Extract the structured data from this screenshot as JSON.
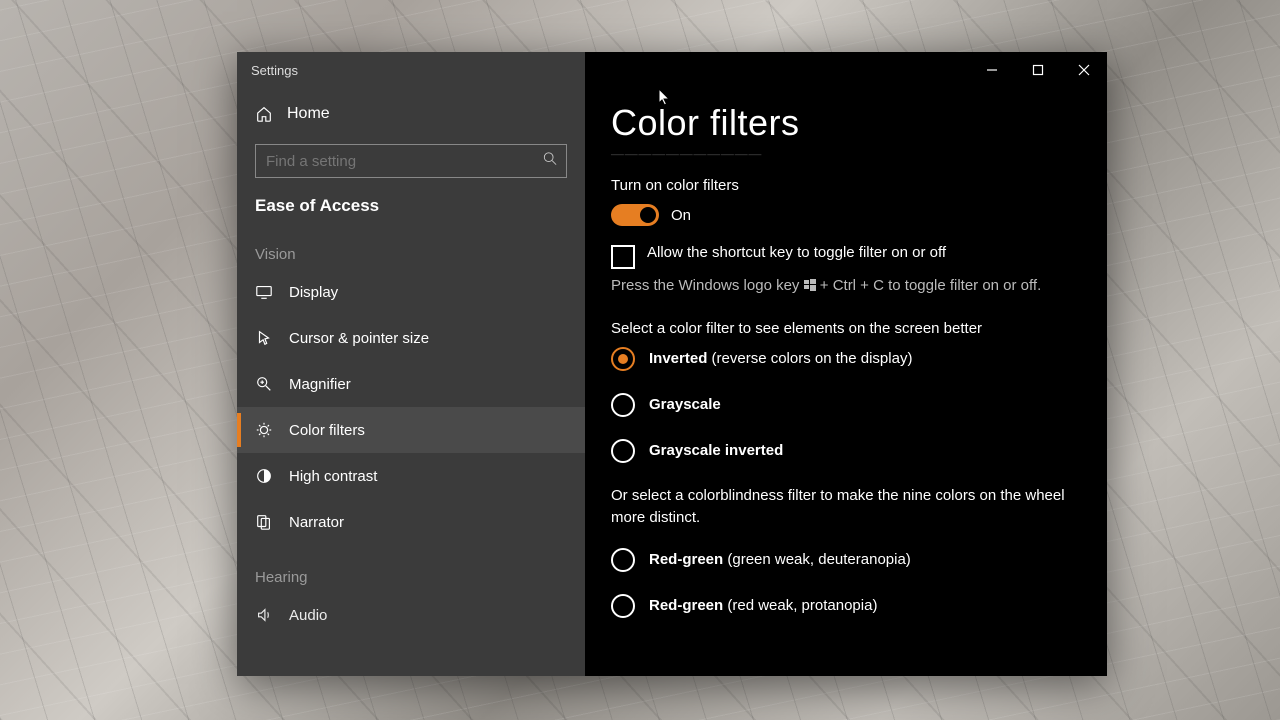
{
  "window": {
    "title": "Settings"
  },
  "sidebar": {
    "home": "Home",
    "searchPlaceholder": "Find a setting",
    "category": "Ease of Access",
    "groups": [
      {
        "label": "Vision",
        "items": [
          {
            "id": "display",
            "label": "Display"
          },
          {
            "id": "cursor",
            "label": "Cursor & pointer size"
          },
          {
            "id": "magnifier",
            "label": "Magnifier"
          },
          {
            "id": "color",
            "label": "Color filters",
            "selected": true
          },
          {
            "id": "contrast",
            "label": "High contrast"
          },
          {
            "id": "narrator",
            "label": "Narrator"
          }
        ]
      },
      {
        "label": "Hearing",
        "items": [
          {
            "id": "audio",
            "label": "Audio"
          }
        ]
      }
    ]
  },
  "page": {
    "title": "Color filters",
    "toggleLabel": "Turn on color filters",
    "toggleState": "On",
    "checkboxLabel": "Allow the shortcut key to toggle filter on or off",
    "hintPrefix": "Press the Windows logo key ",
    "hintSuffix": " + Ctrl + C to toggle filter on or off.",
    "filterHeader": "Select a color filter to see elements on the screen better",
    "radios1": [
      {
        "bold": "Inverted",
        "rest": " (reverse colors on the display)",
        "selected": true
      },
      {
        "bold": "Grayscale",
        "rest": ""
      },
      {
        "bold": "Grayscale inverted",
        "rest": ""
      }
    ],
    "cbHeader": "Or select a colorblindness filter to make the nine colors on the wheel more distinct.",
    "radios2": [
      {
        "bold": "Red-green",
        "rest": " (green weak, deuteranopia)"
      },
      {
        "bold": "Red-green",
        "rest": " (red weak, protanopia)"
      }
    ]
  },
  "colors": {
    "accent": "#e67e22"
  }
}
